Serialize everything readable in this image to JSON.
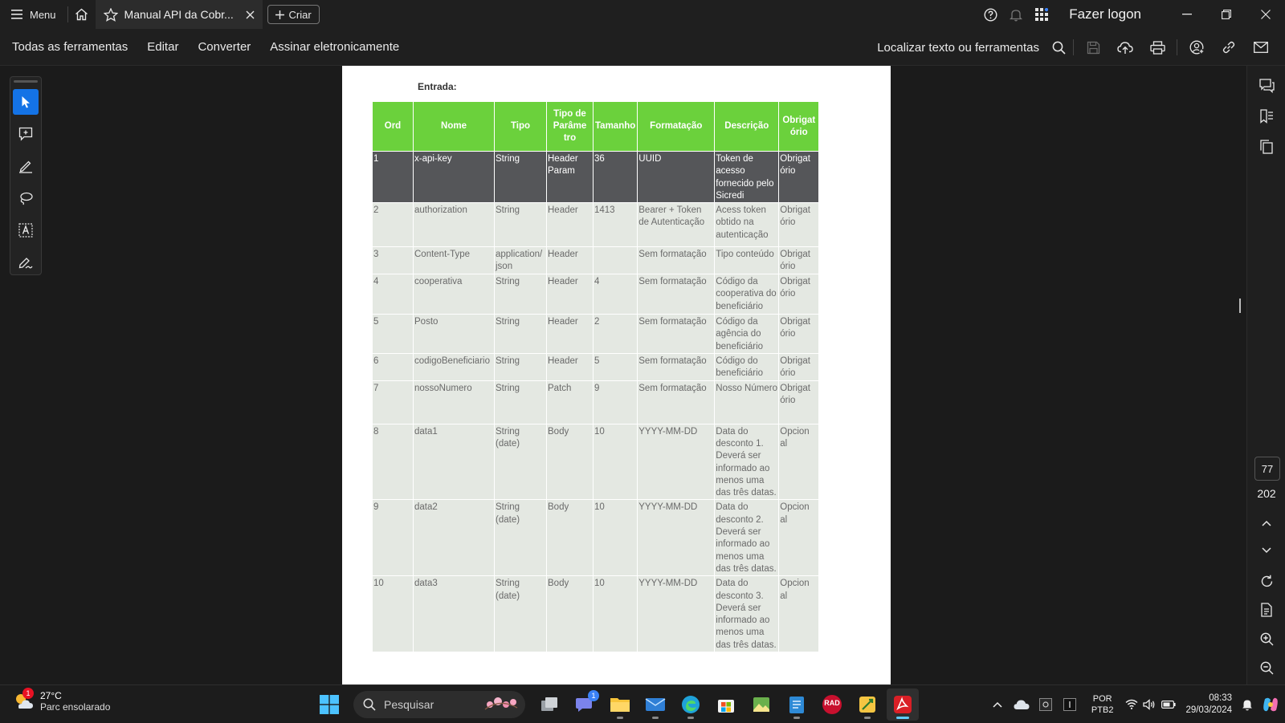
{
  "titlebar": {
    "menu_label": "Menu",
    "tab_title": "Manual API da Cobr...",
    "create_label": "Criar",
    "logon_label": "Fazer logon"
  },
  "toolbar": {
    "all_tools": "Todas as ferramentas",
    "edit": "Editar",
    "convert": "Converter",
    "sign": "Assinar eletronicamente",
    "find": "Localizar texto ou ferramentas"
  },
  "document": {
    "section_label": "Entrada:",
    "headers": [
      "Ord",
      "Nome",
      "Tipo",
      "Tipo de Parâme tro",
      "Tamanho",
      "Formatação",
      "Descrição",
      "Obrigat ório"
    ],
    "rows": [
      [
        "1",
        "x-api-key",
        "String",
        "Header Param",
        "36",
        "UUID",
        "Token de acesso fornecido pelo Sicredi",
        "Obrigat ório"
      ],
      [
        "2",
        "authorization",
        "String",
        "Header",
        "1413",
        "Bearer + Token de Autenticação",
        "Acess token obtido na autenticação",
        "Obrigat ório"
      ],
      [
        "3",
        "Content-Type",
        "application/ json",
        "Header",
        "",
        "Sem formatação",
        "Tipo conteúdo",
        "Obrigat ório"
      ],
      [
        "4",
        "cooperativa",
        "String",
        "Header",
        "4",
        "Sem formatação",
        "Código da cooperativa do beneficiário",
        "Obrigat ório"
      ],
      [
        "5",
        "Posto",
        "String",
        "Header",
        "2",
        "Sem formatação",
        "Código da agência do beneficiário",
        "Obrigat ório"
      ],
      [
        "6",
        "codigoBeneficiario",
        "String",
        "Header",
        "5",
        "Sem formatação",
        "Código do beneficiário",
        "Obrigat ório"
      ],
      [
        "7",
        "nossoNumero",
        "String",
        "Patch",
        "9",
        "Sem formatação",
        "Nosso Número",
        "Obrigat ório"
      ],
      [
        "8",
        "data1",
        "String (date)",
        "Body",
        "10",
        "YYYY-MM-DD",
        "Data do desconto 1. Deverá ser informado ao menos uma das três datas.",
        "Opcion al"
      ],
      [
        "9",
        "data2",
        "String (date)",
        "Body",
        "10",
        "YYYY-MM-DD",
        "Data do desconto 2. Deverá ser informado ao menos uma das três datas.",
        "Opcion al"
      ],
      [
        "10",
        "data3",
        "String (date)",
        "Body",
        "10",
        "YYYY-MM-DD",
        "Data do desconto 3. Deverá ser informado ao menos uma das três datas.",
        "Opcion al"
      ]
    ]
  },
  "navigation": {
    "current_page": "77",
    "total_pages": "202"
  },
  "taskbar": {
    "weather_temp": "27°C",
    "weather_cond": "Parc ensolarado",
    "weather_badge": "1",
    "search_placeholder": "Pesquisar",
    "teams_badge": "1",
    "rad_label": "RAD",
    "lang_1": "POR",
    "lang_2": "PTB2",
    "time": "08:33",
    "date": "29/03/2024"
  },
  "colors": {
    "header_green": "#6bd13c",
    "selected_row": "#555659",
    "accent": "#1473e6"
  }
}
